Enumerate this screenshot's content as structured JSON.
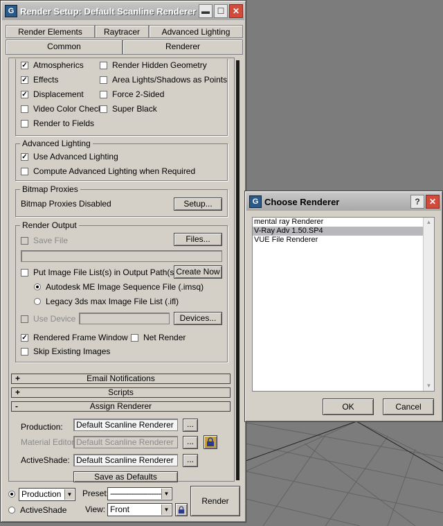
{
  "render_setup": {
    "title": "Render Setup: Default Scanline Renderer",
    "tabs_row1": [
      "Render Elements",
      "Raytracer",
      "Advanced Lighting"
    ],
    "tabs_row2": [
      "Common",
      "Renderer"
    ],
    "options_left": [
      {
        "label": "Atmospherics",
        "checked": true
      },
      {
        "label": "Effects",
        "checked": true
      },
      {
        "label": "Displacement",
        "checked": true
      },
      {
        "label": "Video Color Check",
        "checked": false
      },
      {
        "label": "Render to Fields",
        "checked": false
      }
    ],
    "options_right": [
      {
        "label": "Render Hidden Geometry",
        "checked": false
      },
      {
        "label": "Area Lights/Shadows as Points",
        "checked": false
      },
      {
        "label": "Force 2-Sided",
        "checked": false
      },
      {
        "label": "Super Black",
        "checked": false
      }
    ],
    "advanced_lighting": {
      "title": "Advanced Lighting",
      "use_label": "Use Advanced Lighting",
      "compute_label": "Compute Advanced Lighting when Required"
    },
    "bitmap_proxies": {
      "title": "Bitmap Proxies",
      "status": "Bitmap Proxies Disabled",
      "setup_button": "Setup..."
    },
    "render_output": {
      "title": "Render Output",
      "save_file": "Save File",
      "files_button": "Files...",
      "put_list": "Put Image File List(s) in Output Path(s)",
      "create_now": "Create Now",
      "autodesk_me": "Autodesk ME Image Sequence File (.imsq)",
      "legacy": "Legacy 3ds max Image File List (.ifl)",
      "use_device": "Use Device",
      "devices_button": "Devices...",
      "rendered_frame_window": "Rendered Frame Window",
      "net_render": "Net Render",
      "skip_existing": "Skip Existing Images"
    },
    "rollouts": {
      "email": {
        "sign": "+",
        "label": "Email Notifications"
      },
      "scripts": {
        "sign": "+",
        "label": "Scripts"
      },
      "assign": {
        "sign": "-",
        "label": "Assign Renderer"
      }
    },
    "assign_renderer": {
      "production_label": "Production:",
      "production_value": "Default Scanline Renderer",
      "material_label": "Material Editor:",
      "material_value": "Default Scanline Renderer",
      "activeshade_label": "ActiveShade:",
      "activeshade_value": "Default Scanline Renderer",
      "browse": "...",
      "save_defaults": "Save as Defaults"
    },
    "bottom": {
      "production": "Production",
      "activeshade": "ActiveShade",
      "preset_label": "Preset:",
      "preset_value": "-------------------------",
      "view_label": "View:",
      "view_value": "Front",
      "render_button": "Render"
    }
  },
  "choose_renderer": {
    "title": "Choose Renderer",
    "help": "?",
    "items": [
      "mental ray Renderer",
      "V-Ray Adv 1.50.SP4",
      "VUE File Renderer"
    ],
    "selected_index": 1,
    "ok": "OK",
    "cancel": "Cancel"
  },
  "icons": {
    "app_icon": "3ds-max-icon",
    "lock_icon": "lock-icon",
    "close_icon": "close-icon",
    "minimize_icon": "minimize-icon",
    "maximize_icon": "maximize-icon"
  },
  "colors": {
    "window_bg": "#d4d0c8",
    "viewport_bg": "#7c7c7c",
    "list_selection": "#b8b8bc",
    "close_red": "#d24a3a"
  }
}
